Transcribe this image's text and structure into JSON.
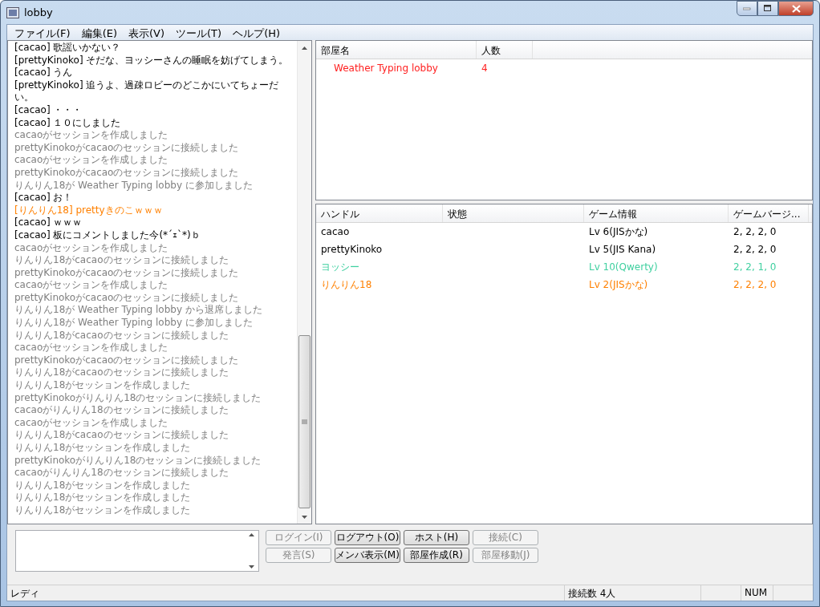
{
  "window": {
    "title": "lobby"
  },
  "menu": [
    "ファイル(F)",
    "編集(E)",
    "表示(V)",
    "ツール(T)",
    "ヘルプ(H)"
  ],
  "chat": [
    {
      "text": "[cacao] 歌謡いかない？",
      "color": "#000000"
    },
    {
      "text": "[prettyKinoko] そだな、ヨッシーさんの睡眠を妨げてしまう。",
      "color": "#000000"
    },
    {
      "text": "[cacao] うん",
      "color": "#000000"
    },
    {
      "text": "[prettyKinoko] 追うよ、過疎ロビーのどこかにいてちょーだい。",
      "color": "#000000"
    },
    {
      "text": "[cacao] ・・・",
      "color": "#000000"
    },
    {
      "text": "[cacao] １０にしました",
      "color": "#000000"
    },
    {
      "text": "cacaoがセッションを作成しました",
      "color": "#808080"
    },
    {
      "text": "prettyKinokoがcacaoのセッションに接続しました",
      "color": "#808080"
    },
    {
      "text": "cacaoがセッションを作成しました",
      "color": "#808080"
    },
    {
      "text": "prettyKinokoがcacaoのセッションに接続しました",
      "color": "#808080"
    },
    {
      "text": "りんりん18が Weather Typing lobby に参加しました",
      "color": "#808080"
    },
    {
      "text": "[cacao] お！",
      "color": "#000000"
    },
    {
      "text": "[りんりん18] prettyきのこｗｗｗ",
      "color": "#ff8000"
    },
    {
      "text": "[cacao] ｗｗｗ",
      "color": "#000000"
    },
    {
      "text": "[cacao] 板にコメントしました今(*´ｪ`*)ｂ",
      "color": "#000000"
    },
    {
      "text": "cacaoがセッションを作成しました",
      "color": "#808080"
    },
    {
      "text": "りんりん18がcacaoのセッションに接続しました",
      "color": "#808080"
    },
    {
      "text": "prettyKinokoがcacaoのセッションに接続しました",
      "color": "#808080"
    },
    {
      "text": "cacaoがセッションを作成しました",
      "color": "#808080"
    },
    {
      "text": "prettyKinokoがcacaoのセッションに接続しました",
      "color": "#808080"
    },
    {
      "text": "りんりん18が Weather Typing lobby から退席しました",
      "color": "#808080"
    },
    {
      "text": "りんりん18が Weather Typing lobby に参加しました",
      "color": "#808080"
    },
    {
      "text": "りんりん18がcacaoのセッションに接続しました",
      "color": "#808080"
    },
    {
      "text": "cacaoがセッションを作成しました",
      "color": "#808080"
    },
    {
      "text": "prettyKinokoがcacaoのセッションに接続しました",
      "color": "#808080"
    },
    {
      "text": "りんりん18がcacaoのセッションに接続しました",
      "color": "#808080"
    },
    {
      "text": "りんりん18がセッションを作成しました",
      "color": "#808080"
    },
    {
      "text": "prettyKinokoがりんりん18のセッションに接続しました",
      "color": "#808080"
    },
    {
      "text": "cacaoがりんりん18のセッションに接続しました",
      "color": "#808080"
    },
    {
      "text": "cacaoがセッションを作成しました",
      "color": "#808080"
    },
    {
      "text": "りんりん18がcacaoのセッションに接続しました",
      "color": "#808080"
    },
    {
      "text": "りんりん18がセッションを作成しました",
      "color": "#808080"
    },
    {
      "text": "prettyKinokoがりんりん18のセッションに接続しました",
      "color": "#808080"
    },
    {
      "text": "cacaoがりんりん18のセッションに接続しました",
      "color": "#808080"
    },
    {
      "text": "りんりん18がセッションを作成しました",
      "color": "#808080"
    },
    {
      "text": "りんりん18がセッションを作成しました",
      "color": "#808080"
    },
    {
      "text": "りんりん18がセッションを作成しました",
      "color": "#808080"
    }
  ],
  "rooms": {
    "columns": [
      "部屋名",
      "人数"
    ],
    "rows": [
      {
        "name": "Weather Typing lobby",
        "count": "4",
        "color": "#ff2020"
      }
    ]
  },
  "members": {
    "columns": [
      "ハンドル",
      "状態",
      "ゲーム情報",
      "ゲームバージ..."
    ],
    "rows": [
      {
        "handle": "cacao",
        "info": "Lv 6(JISかな)",
        "version": "2, 2, 2, 0",
        "color": "#000000"
      },
      {
        "handle": "prettyKinoko",
        "info": "Lv 5(JIS Kana)",
        "version": "2, 2, 2, 0",
        "color": "#000000"
      },
      {
        "handle": "ヨッシー",
        "info": "Lv 10(Qwerty)",
        "version": "2, 2, 1, 0",
        "color": "#40d0a0"
      },
      {
        "handle": "りんりん18",
        "info": "Lv 2(JISかな)",
        "version": "2, 2, 2, 0",
        "color": "#ff8000"
      }
    ]
  },
  "buttons": [
    {
      "label": "ログイン(I)",
      "disabled": true
    },
    {
      "label": "ログアウト(O)",
      "disabled": false
    },
    {
      "label": "ホスト(H)",
      "disabled": false
    },
    {
      "label": "接続(C)",
      "disabled": true
    },
    {
      "label": "発言(S)",
      "disabled": true
    },
    {
      "label": "メンバ表示(M)",
      "disabled": false
    },
    {
      "label": "部屋作成(R)",
      "disabled": false
    },
    {
      "label": "部屋移動(J)",
      "disabled": true
    }
  ],
  "status_bar": {
    "message": "レディ",
    "connections": "接続数 4人",
    "num": "NUM"
  }
}
